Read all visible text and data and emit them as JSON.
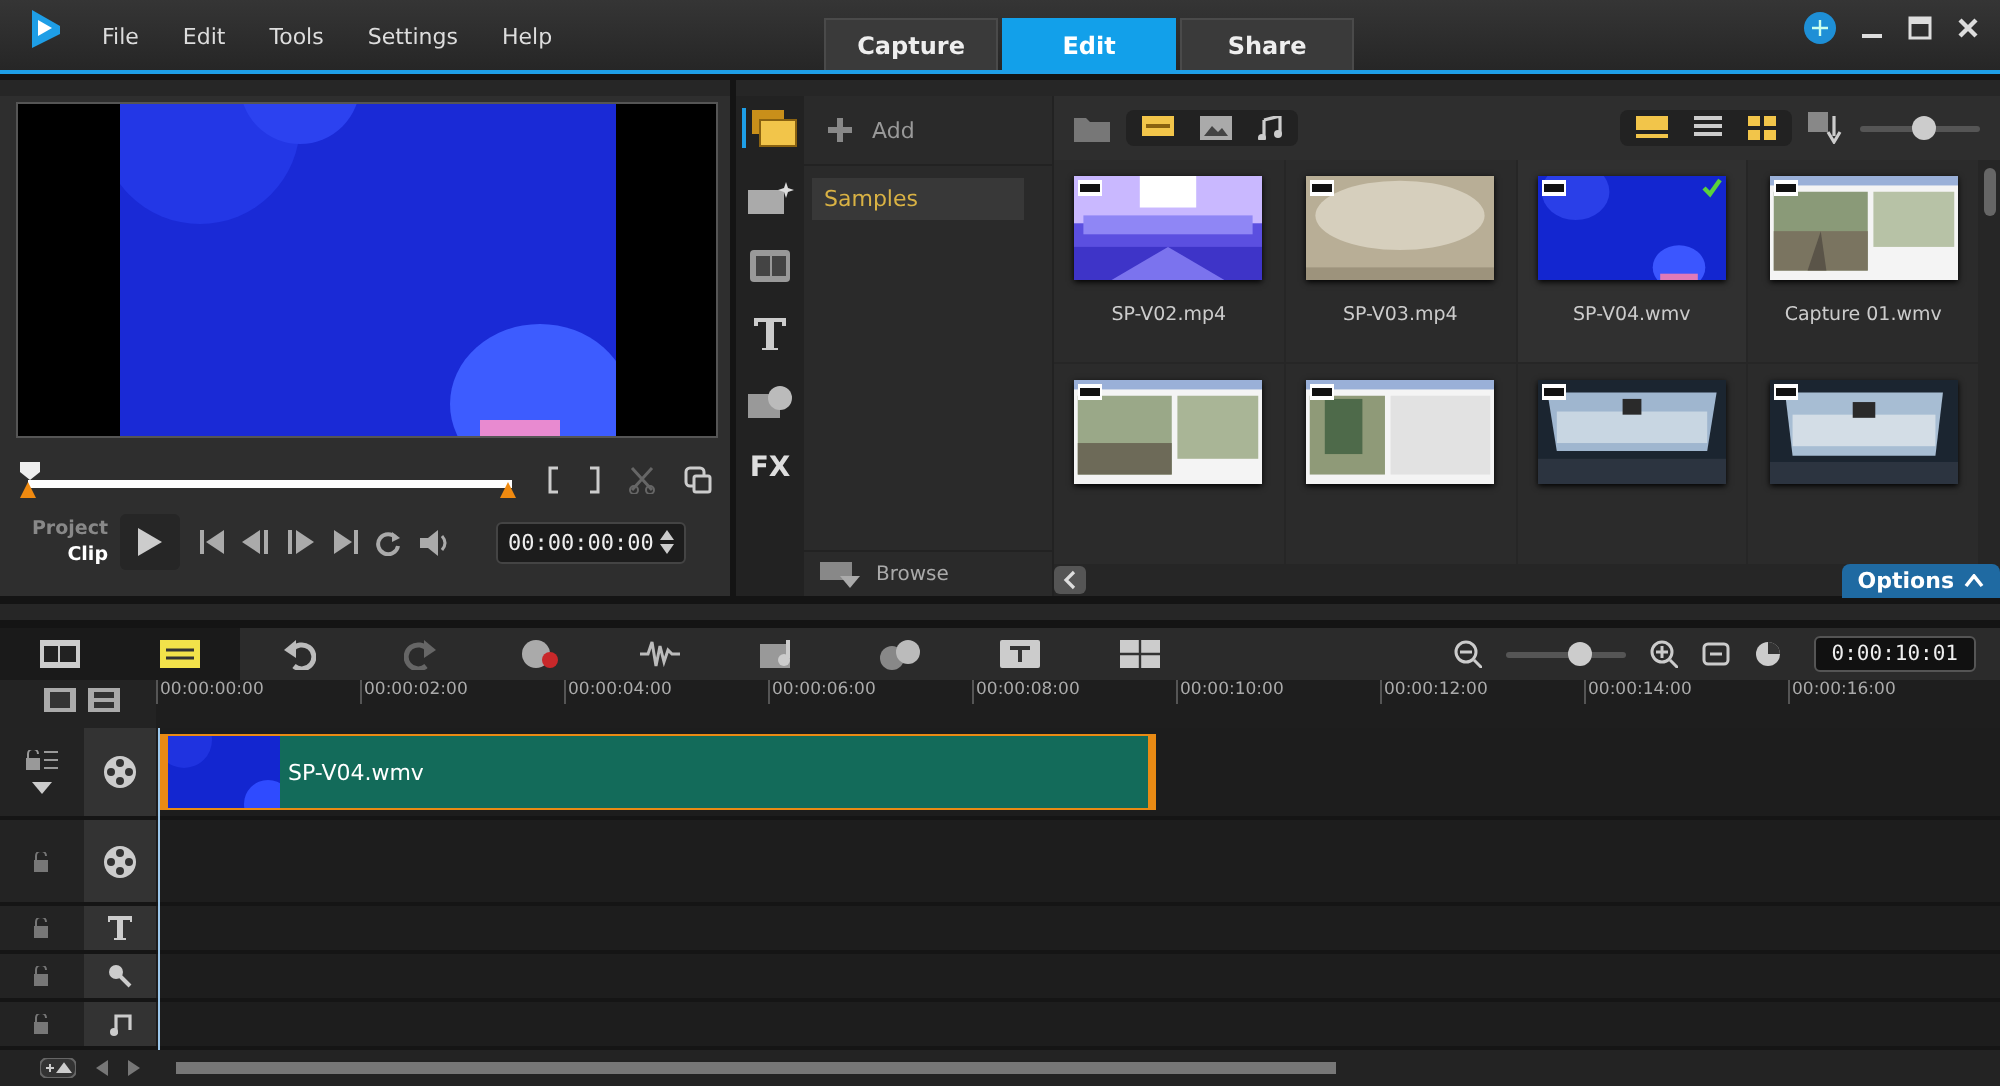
{
  "menu": [
    "File",
    "Edit",
    "Tools",
    "Settings",
    "Help"
  ],
  "tabs": [
    {
      "label": "Capture",
      "selected": false
    },
    {
      "label": "Edit",
      "selected": true
    },
    {
      "label": "Share",
      "selected": false
    }
  ],
  "player": {
    "scrub": {
      "level": 0
    },
    "modes": [
      {
        "label": "Project",
        "selected": false
      },
      {
        "label": "Clip",
        "selected": true
      }
    ],
    "timecode": "00:00:00:00"
  },
  "library": {
    "fx": "FX",
    "add": "Add",
    "folders": [
      {
        "label": "Samples",
        "selected": true
      }
    ],
    "browse": "Browse",
    "options": "Options",
    "thumb_size": {
      "level": 0.55
    },
    "media": [
      {
        "name": "SP-V02.mp4",
        "selected": false
      },
      {
        "name": "SP-V03.mp4",
        "selected": false
      },
      {
        "name": "SP-V04.wmv",
        "selected": true
      },
      {
        "name": "Capture 01.wmv",
        "selected": false
      },
      {
        "selected": false
      },
      {
        "selected": false
      },
      {
        "selected": false
      },
      {
        "selected": false
      }
    ]
  },
  "timeline": {
    "zoom": {
      "level": 0.65
    },
    "duration": "0:00:10:01",
    "ruler": [
      "00:00:00:00",
      "00:00:02:00",
      "00:00:04:00",
      "00:00:06:00",
      "00:00:08:00",
      "00:00:10:00",
      "00:00:12:00",
      "00:00:14:00",
      "00:00:16:00"
    ],
    "clip": {
      "name": "SP-V04.wmv"
    }
  }
}
